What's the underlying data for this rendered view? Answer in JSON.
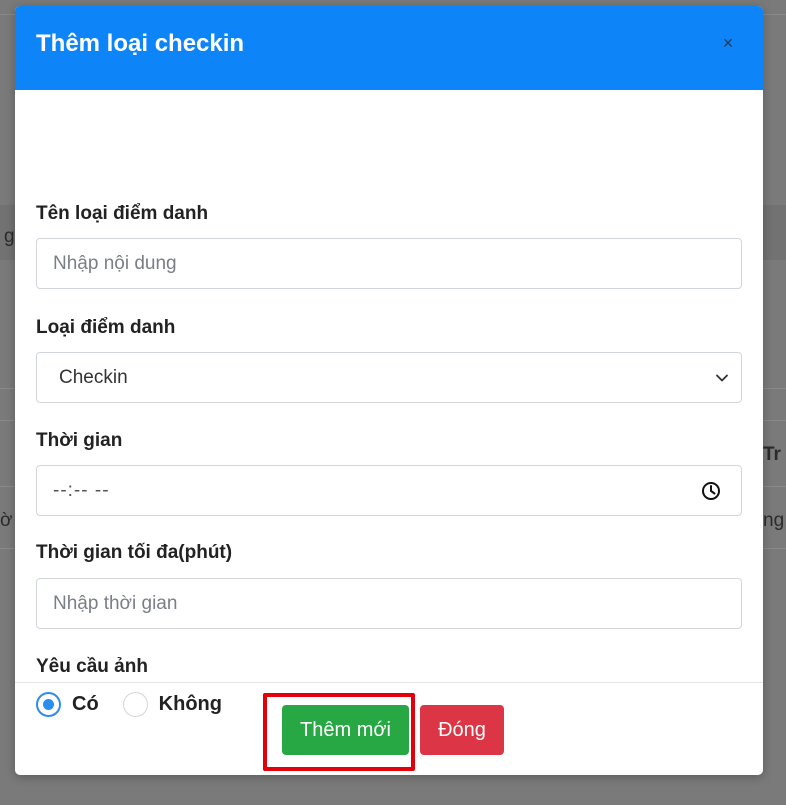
{
  "background": {
    "fragments": [
      "g",
      "Tr",
      "ờ",
      "ng"
    ]
  },
  "modal": {
    "title": "Thêm loại checkin",
    "close_symbol": "×",
    "fields": {
      "name": {
        "label": "Tên loại điểm danh",
        "placeholder": "Nhập nội dung",
        "value": ""
      },
      "type": {
        "label": "Loại điểm danh",
        "selected": "Checkin"
      },
      "time": {
        "label": "Thời gian",
        "display": "--:--  --"
      },
      "max_time": {
        "label": "Thời gian tối đa(phút)",
        "placeholder": "Nhập thời gian",
        "value": ""
      },
      "photo_required": {
        "label": "Yêu cầu ảnh",
        "options": [
          {
            "label": "Có",
            "checked": true
          },
          {
            "label": "Không",
            "checked": false
          }
        ]
      }
    },
    "buttons": {
      "submit": "Thêm mới",
      "close": "Đóng"
    }
  },
  "colors": {
    "header": "#0d84f7",
    "submit": "#28a745",
    "close": "#dc3545",
    "radio_accent": "#2a8df0",
    "highlight": "#e3000b"
  },
  "icons": {
    "select": "chevron-down-icon",
    "time": "clock-icon",
    "close": "close-icon"
  }
}
